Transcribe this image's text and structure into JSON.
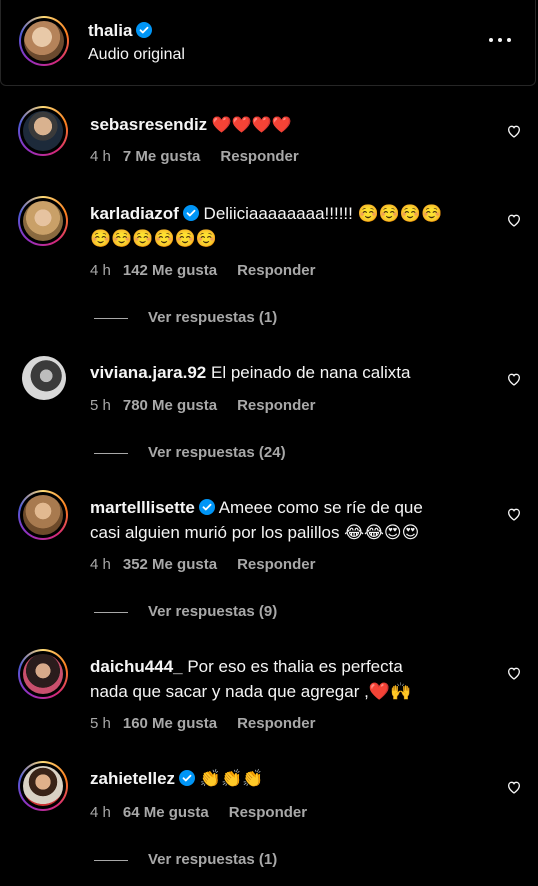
{
  "header": {
    "username": "thalia",
    "subtitle": "Audio original",
    "more_icon": "more-horizontal-icon"
  },
  "comments": [
    {
      "username": "sebasresendiz",
      "verified": false,
      "text": "❤️❤️❤️❤️",
      "time": "4 h",
      "likes": "7 Me gusta",
      "reply": "Responder",
      "replies": ""
    },
    {
      "username": "karladiazof",
      "verified": true,
      "text": "Deliiciaaaaaaaa!!!!!! ☺️☺️☺️☺️",
      "text2": "☺️☺️☺️☺️☺️☺️",
      "time": "4 h",
      "likes": "142 Me gusta",
      "reply": "Responder",
      "replies": "Ver respuestas (1)"
    },
    {
      "username": "viviana.jara.92",
      "verified": false,
      "text": "El peinado de nana calixta",
      "time": "5 h",
      "likes": "780 Me gusta",
      "reply": "Responder",
      "replies": "Ver respuestas (24)"
    },
    {
      "username": "martelllisette",
      "verified": true,
      "text": "Ameee como se ríe de que",
      "text2": "casi alguien murió por los palillos 😂😂😍😍",
      "time": "4 h",
      "likes": "352 Me gusta",
      "reply": "Responder",
      "replies": "Ver respuestas (9)"
    },
    {
      "username": "daichu444_",
      "verified": false,
      "text": "Por eso es thalia es perfecta",
      "text2": "nada que sacar y nada que agregar ,❤️🙌",
      "time": "5 h",
      "likes": "160 Me gusta",
      "reply": "Responder",
      "replies": ""
    },
    {
      "username": "zahietellez",
      "verified": true,
      "text": "👏👏👏",
      "time": "4 h",
      "likes": "64 Me gusta",
      "reply": "Responder",
      "replies": "Ver respuestas (1)"
    }
  ],
  "colors": {
    "background": "#000000",
    "text": "#f5f5f5",
    "secondary": "#a8a8a8",
    "verified": "#0095f6"
  }
}
